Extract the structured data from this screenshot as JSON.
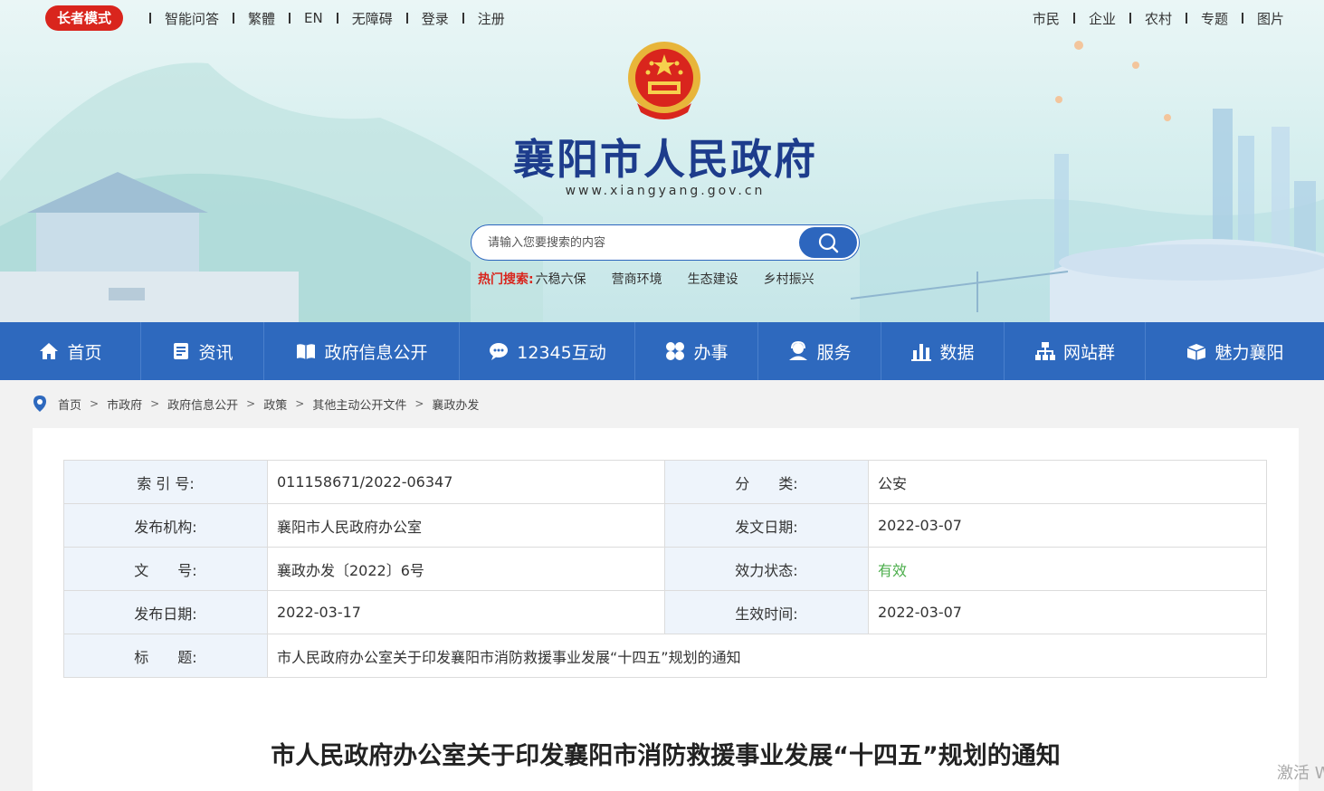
{
  "topbar": {
    "elder_mode": "长者模式",
    "left_links": [
      "智能问答",
      "繁體",
      "EN",
      "无障碍",
      "登录",
      "注册"
    ],
    "right_links": [
      "市民",
      "企业",
      "农村",
      "专题",
      "图片"
    ]
  },
  "header": {
    "title": "襄阳市人民政府",
    "url": "www.xiangyang.gov.cn"
  },
  "search": {
    "placeholder": "请输入您要搜索的内容",
    "hot_label": "热门搜索:",
    "hot_items": [
      "六稳六保",
      "营商环境",
      "生态建设",
      "乡村振兴"
    ]
  },
  "nav": [
    {
      "label": "首页",
      "icon": "home-icon"
    },
    {
      "label": "资讯",
      "icon": "news-icon"
    },
    {
      "label": "政府信息公开",
      "icon": "book-icon"
    },
    {
      "label": "12345互动",
      "icon": "chat-icon"
    },
    {
      "label": "办事",
      "icon": "grid-icon"
    },
    {
      "label": "服务",
      "icon": "user-service-icon"
    },
    {
      "label": "数据",
      "icon": "bar-chart-icon"
    },
    {
      "label": "网站群",
      "icon": "sitemap-icon"
    },
    {
      "label": "魅力襄阳",
      "icon": "box-icon"
    }
  ],
  "breadcrumb": [
    "首页",
    "市政府",
    "政府信息公开",
    "政策",
    "其他主动公开文件",
    "襄政办发"
  ],
  "meta": {
    "index_label": "索 引 号:",
    "index_value": "011158671/2022-06347",
    "category_label": "分　　类:",
    "category_value": "公安",
    "org_label": "发布机构:",
    "org_value": "襄阳市人民政府办公室",
    "issue_date_label": "发文日期:",
    "issue_date_value": "2022-03-07",
    "doc_no_label": "文　　号:",
    "doc_no_value": "襄政办发〔2022〕6号",
    "status_label": "效力状态:",
    "status_value": "有效",
    "pub_date_label": "发布日期:",
    "pub_date_value": "2022-03-17",
    "effective_label": "生效时间:",
    "effective_value": "2022-03-07",
    "title_label": "标　　题:",
    "title_value": "市人民政府办公室关于印发襄阳市消防救援事业发展“十四五”规划的通知"
  },
  "document": {
    "title": "市人民政府办公室关于印发襄阳市消防救援事业发展“十四五”规划的通知"
  },
  "watermark": "激活 W",
  "colors": {
    "brand_blue": "#2e69be",
    "red": "#d9251d",
    "green": "#4cae4c",
    "title_navy": "#1d3c8c"
  }
}
